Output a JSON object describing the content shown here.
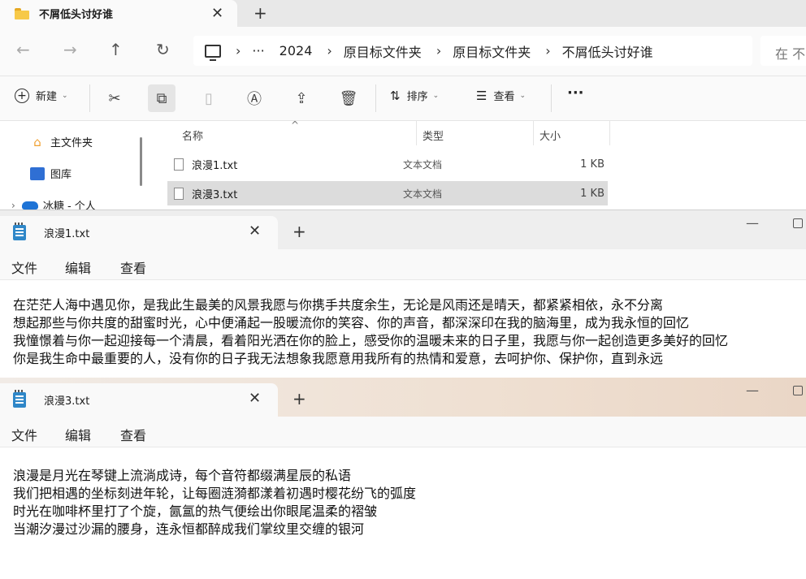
{
  "explorer": {
    "tab_title": "不屑低头讨好谁",
    "tab_close": "✕",
    "new_tab": "+",
    "nav": {
      "back": "←",
      "forward": "→",
      "up": "↑",
      "refresh": "↻"
    },
    "breadcrumb": [
      "···",
      "2024",
      "原目标文件夹",
      "原目标文件夹",
      "不屑低头讨好谁"
    ],
    "search_placeholder": "在 不",
    "toolbar": {
      "new_label": "新建",
      "sort_label": "排序",
      "view_label": "查看",
      "more": "···"
    },
    "sidebar": [
      {
        "label": "主文件夹",
        "icon": "home-icon"
      },
      {
        "label": "图库",
        "icon": "gallery-icon"
      },
      {
        "label": "冰糖 - 个人",
        "icon": "cloud-icon"
      }
    ],
    "columns": {
      "name": "名称",
      "type": "类型",
      "size": "大小"
    },
    "files": [
      {
        "name": "浪漫1.txt",
        "type": "文本文档",
        "size": "1 KB",
        "selected": false
      },
      {
        "name": "浪漫3.txt",
        "type": "文本文档",
        "size": "1 KB",
        "selected": true
      }
    ]
  },
  "notepad1": {
    "tab_title": "浪漫1.txt",
    "menu": [
      "文件",
      "编辑",
      "查看"
    ],
    "lines": [
      "在茫茫人海中遇见你，是我此生最美的风景我愿与你携手共度余生，无论是风雨还是晴天，都紧紧相依，永不分离",
      "想起那些与你共度的甜蜜时光，心中便涌起一股暖流你的笑容、你的声音，都深深印在我的脑海里，成为我永恒的回忆",
      "我憧憬着与你一起迎接每一个清晨，看着阳光洒在你的脸上，感受你的温暖未来的日子里，我愿与你一起创造更多美好的回忆",
      "你是我生命中最重要的人，没有你的日子我无法想象我愿意用我所有的热情和爱意，去呵护你、保护你，直到永远"
    ]
  },
  "notepad2": {
    "tab_title": "浪漫3.txt",
    "menu": [
      "文件",
      "编辑",
      "查看"
    ],
    "lines": [
      "浪漫是月光在琴键上流淌成诗，每个音符都缀满星辰的私语",
      "我们把相遇的坐标刻进年轮，让每圈涟漪都漾着初遇时樱花纷飞的弧度",
      "时光在咖啡杯里打了个旋，氤氲的热气便绘出你眼尾温柔的褶皱",
      "当潮汐漫过沙漏的腰身，连永恒都醉成我们掌纹里交缠的银河"
    ]
  }
}
